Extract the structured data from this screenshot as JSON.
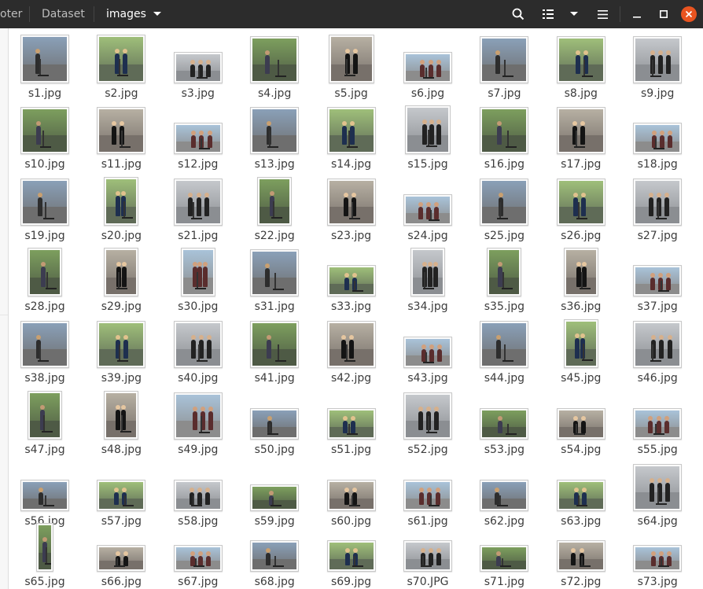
{
  "window": {
    "breadcrumbs": [
      {
        "label": "oter",
        "active": false
      },
      {
        "label": "Dataset",
        "active": false
      },
      {
        "label": "images",
        "active": true
      }
    ]
  },
  "toolbar": {
    "icons": [
      "search-icon",
      "list-view-icon",
      "view-options-icon",
      "menu-icon",
      "minimize-icon",
      "maximize-icon",
      "close-icon"
    ],
    "close_color": "#e95420"
  },
  "files": [
    {
      "name": "s1.jpg",
      "shape": "portrait"
    },
    {
      "name": "s2.jpg",
      "shape": "portrait"
    },
    {
      "name": "s3.jpg",
      "shape": "wide"
    },
    {
      "name": "s4.jpg",
      "shape": "square"
    },
    {
      "name": "s5.jpg",
      "shape": "tall"
    },
    {
      "name": "s6.jpg",
      "shape": "wide"
    },
    {
      "name": "s7.jpg",
      "shape": "square"
    },
    {
      "name": "s8.jpg",
      "shape": "square"
    },
    {
      "name": "s9.jpg",
      "shape": "square"
    },
    {
      "name": "s10.jpg",
      "shape": "square"
    },
    {
      "name": "s11.jpg",
      "shape": "square"
    },
    {
      "name": "s12.jpg",
      "shape": "wide"
    },
    {
      "name": "s13.jpg",
      "shape": "square"
    },
    {
      "name": "s14.jpg",
      "shape": "square"
    },
    {
      "name": "s15.jpg",
      "shape": "tall"
    },
    {
      "name": "s16.jpg",
      "shape": "square"
    },
    {
      "name": "s17.jpg",
      "shape": "square"
    },
    {
      "name": "s18.jpg",
      "shape": "wide"
    },
    {
      "name": "s19.jpg",
      "shape": "square"
    },
    {
      "name": "s20.jpg",
      "shape": "narrow"
    },
    {
      "name": "s21.jpg",
      "shape": "square"
    },
    {
      "name": "s22.jpg",
      "shape": "narrow"
    },
    {
      "name": "s23.jpg",
      "shape": "square"
    },
    {
      "name": "s24.jpg",
      "shape": "wide"
    },
    {
      "name": "s25.jpg",
      "shape": "square"
    },
    {
      "name": "s26.jpg",
      "shape": "square"
    },
    {
      "name": "s27.jpg",
      "shape": "square"
    },
    {
      "name": "s28.jpg",
      "shape": "narrow"
    },
    {
      "name": "s29.jpg",
      "shape": "narrow"
    },
    {
      "name": "s30.jpg",
      "shape": "narrow"
    },
    {
      "name": "s31.jpg",
      "shape": "square"
    },
    {
      "name": "s33.jpg",
      "shape": "wide"
    },
    {
      "name": "s34.jpg",
      "shape": "narrow"
    },
    {
      "name": "s35.jpg",
      "shape": "narrow"
    },
    {
      "name": "s36.jpg",
      "shape": "narrow"
    },
    {
      "name": "s37.jpg",
      "shape": "wide"
    },
    {
      "name": "s38.jpg",
      "shape": "square"
    },
    {
      "name": "s39.jpg",
      "shape": "square"
    },
    {
      "name": "s40.jpg",
      "shape": "square"
    },
    {
      "name": "s41.jpg",
      "shape": "square"
    },
    {
      "name": "s42.jpg",
      "shape": "square"
    },
    {
      "name": "s43.jpg",
      "shape": "wide"
    },
    {
      "name": "s44.jpg",
      "shape": "square"
    },
    {
      "name": "s45.jpg",
      "shape": "narrow"
    },
    {
      "name": "s46.jpg",
      "shape": "square"
    },
    {
      "name": "s47.jpg",
      "shape": "narrow"
    },
    {
      "name": "s48.jpg",
      "shape": "narrow"
    },
    {
      "name": "s49.jpg",
      "shape": "square"
    },
    {
      "name": "s50.jpg",
      "shape": "wide"
    },
    {
      "name": "s51.jpg",
      "shape": "wide"
    },
    {
      "name": "s52.jpg",
      "shape": "square"
    },
    {
      "name": "s53.jpg",
      "shape": "wide"
    },
    {
      "name": "s54.jpg",
      "shape": "wide"
    },
    {
      "name": "s55.jpg",
      "shape": "wide"
    },
    {
      "name": "s56.jpg",
      "shape": "wide"
    },
    {
      "name": "s57.jpg",
      "shape": "wide"
    },
    {
      "name": "s58.jpg",
      "shape": "wide"
    },
    {
      "name": "s59.jpg",
      "shape": "flat"
    },
    {
      "name": "s60.jpg",
      "shape": "wide"
    },
    {
      "name": "s61.jpg",
      "shape": "wide"
    },
    {
      "name": "s62.jpg",
      "shape": "wide"
    },
    {
      "name": "s63.jpg",
      "shape": "wide"
    },
    {
      "name": "s64.jpg",
      "shape": "square"
    },
    {
      "name": "s65.jpg",
      "shape": "slim"
    },
    {
      "name": "s66.jpg",
      "shape": "flat"
    },
    {
      "name": "s67.jpg",
      "shape": "flat"
    },
    {
      "name": "s68.jpg",
      "shape": "wide"
    },
    {
      "name": "s69.jpg",
      "shape": "wide"
    },
    {
      "name": "s70.JPG",
      "shape": "wide"
    },
    {
      "name": "s71.jpg",
      "shape": "flat"
    },
    {
      "name": "s72.jpg",
      "shape": "wide"
    },
    {
      "name": "s73.jpg",
      "shape": "flat"
    }
  ]
}
